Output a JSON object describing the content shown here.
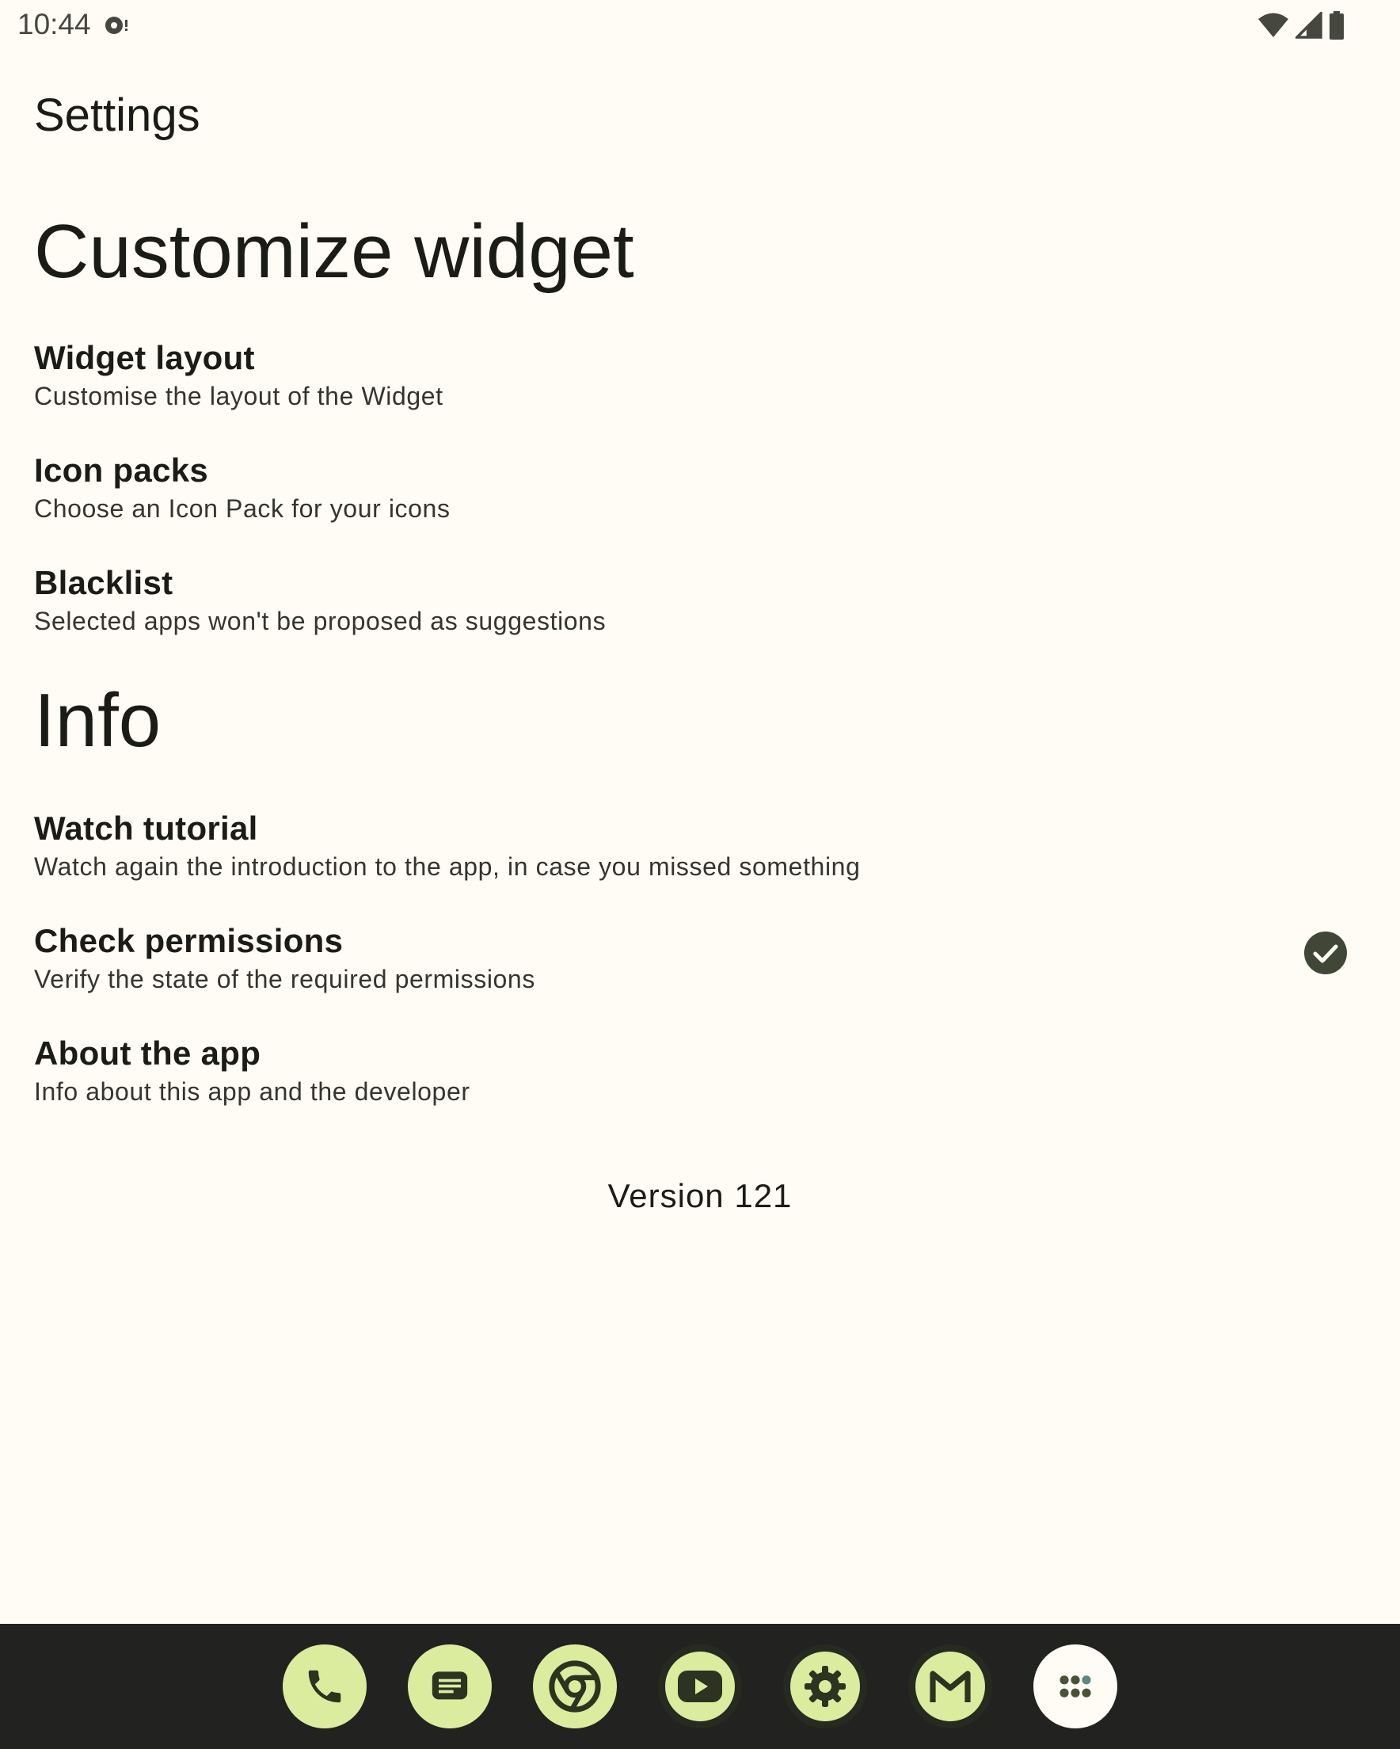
{
  "status_bar": {
    "time": "10:44"
  },
  "app_bar": {
    "title": "Settings"
  },
  "sections": {
    "customize": {
      "header": "Customize widget",
      "items": [
        {
          "title": "Widget layout",
          "summary": "Customise the layout of the Widget"
        },
        {
          "title": "Icon packs",
          "summary": "Choose an Icon Pack for your icons"
        },
        {
          "title": "Blacklist",
          "summary": "Selected apps won't be proposed as suggestions"
        }
      ]
    },
    "info": {
      "header": "Info",
      "items": [
        {
          "title": "Watch tutorial",
          "summary": "Watch again the introduction to the app, in case you missed something"
        },
        {
          "title": "Check permissions",
          "summary": "Verify the state of the required permissions",
          "status_icon": "check-circle-icon"
        },
        {
          "title": "About the app",
          "summary": "Info about this app and the developer"
        }
      ]
    }
  },
  "version": "Version 121",
  "dock": {
    "icons": [
      "phone-icon",
      "messages-icon",
      "chrome-icon",
      "youtube-icon",
      "settings-gear-icon",
      "gmail-icon",
      "app-drawer-icon"
    ]
  },
  "colors": {
    "background": "#fefcf4",
    "dock_background": "#222220",
    "dock_icon_fill": "#dcec9f",
    "check_icon": "#404737"
  }
}
